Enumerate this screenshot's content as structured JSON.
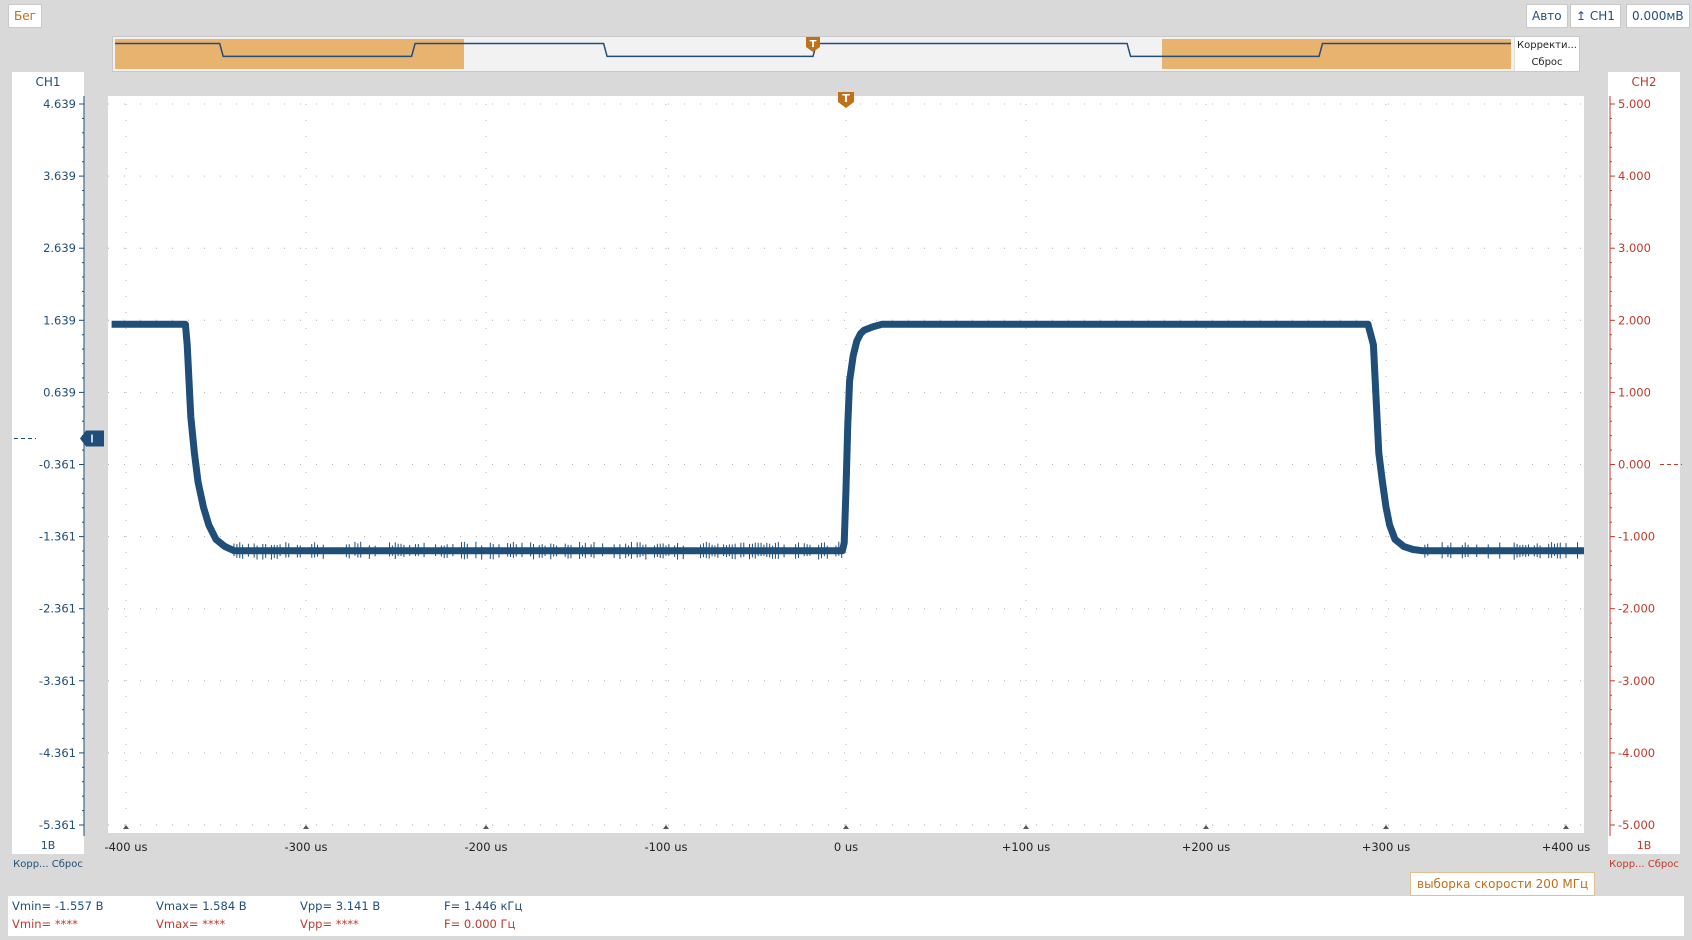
{
  "toolbar": {
    "run_label": "Бег",
    "auto_label": "Авто",
    "trigger_source": "CH1",
    "trigger_level": "0.000мВ"
  },
  "overview": {
    "correct_label": "Корректи...",
    "reset_label": "Сброс",
    "trigger_marker": "T"
  },
  "channels": {
    "ch1": {
      "label": "CH1",
      "scale": "1В",
      "correct_label": "Корр... Сброс",
      "color": "#1f4e79"
    },
    "ch2": {
      "label": "CH2",
      "scale": "1В",
      "correct_label": "Корр... Сброс",
      "color": "#c0392b"
    }
  },
  "sample_rate_label": "выборка скорости 200 МГц",
  "measurements": {
    "ch1": {
      "vmin": "Vmin= -1.557 В",
      "vmax": "Vmax= 1.584 В",
      "vpp": "Vpp= 3.141 В",
      "freq": "F= 1.446 кГц"
    },
    "ch2": {
      "vmin": "Vmin= ****",
      "vmax": "Vmax= ****",
      "vpp": "Vpp= ****",
      "freq": "F= 0.000 Гц"
    }
  },
  "colors": {
    "trace": "#1f4e79",
    "trigger": "#c07018",
    "highlight": "#e8b26f"
  },
  "chart_data": {
    "type": "line",
    "x_tick_labels": [
      "-400 us",
      "-300 us",
      "-200 us",
      "-100 us",
      "0 us",
      "+100 us",
      "+200 us",
      "+300 us",
      "+400 us"
    ],
    "x_ticks": [
      -400,
      -300,
      -200,
      -100,
      0,
      100,
      200,
      300,
      400
    ],
    "xlim": [
      -410,
      410
    ],
    "y_left_tick_labels": [
      "4.639",
      "3.639",
      "2.639",
      "1.639",
      "0.639",
      "-0.361",
      "-1.361",
      "-2.361",
      "-3.361",
      "-4.361",
      "-5.361"
    ],
    "y_left_ticks": [
      4.639,
      3.639,
      2.639,
      1.639,
      0.639,
      -0.361,
      -1.361,
      -2.361,
      -3.361,
      -4.361,
      -5.361
    ],
    "ylim": [
      -5.361,
      4.639
    ],
    "y_right_tick_labels": [
      "5.000",
      "4.000",
      "3.000",
      "2.000",
      "1.000",
      "0.000",
      "-1.000",
      "-2.000",
      "-3.000",
      "-4.000",
      "-5.000"
    ],
    "y_right_ticks": [
      5,
      4,
      3,
      2,
      1,
      0,
      -1,
      -2,
      -3,
      -4,
      -5
    ],
    "grid": true,
    "series": [
      {
        "channel": "CH1",
        "x": [
          -408,
          -367,
          -366,
          -365,
          -364,
          -362,
          -360,
          -357,
          -354,
          -350,
          -345,
          -340,
          -300,
          -200,
          -100,
          -2,
          -1,
          0,
          1,
          2,
          4,
          6,
          8,
          10,
          15,
          20,
          100,
          200,
          290,
          293,
          294,
          295,
          296,
          298,
          300,
          302,
          305,
          310,
          315,
          320,
          360,
          410
        ],
        "y": [
          1.584,
          1.584,
          1.3,
          0.8,
          0.3,
          -0.2,
          -0.6,
          -0.95,
          -1.2,
          -1.4,
          -1.5,
          -1.557,
          -1.557,
          -1.557,
          -1.557,
          -1.557,
          -1.45,
          -0.7,
          0.2,
          0.8,
          1.15,
          1.35,
          1.45,
          1.5,
          1.55,
          1.584,
          1.584,
          1.584,
          1.584,
          1.3,
          0.8,
          0.3,
          -0.2,
          -0.6,
          -0.95,
          -1.2,
          -1.4,
          -1.5,
          -1.54,
          -1.557,
          -1.557,
          -1.557
        ]
      }
    ],
    "overview_waveform": {
      "x": [
        -2000,
        -1700,
        -1690,
        -1150,
        -1140,
        -600,
        -590,
        0,
        10,
        900,
        910,
        1450,
        1460,
        2000
      ],
      "y": [
        1.584,
        1.584,
        -1.557,
        -1.557,
        1.584,
        1.584,
        -1.557,
        -1.557,
        1.584,
        1.584,
        -1.557,
        -1.557,
        1.584,
        1.584
      ],
      "highlight_ranges": [
        [
          -2000,
          -1000
        ],
        [
          1000,
          2000
        ]
      ]
    }
  }
}
